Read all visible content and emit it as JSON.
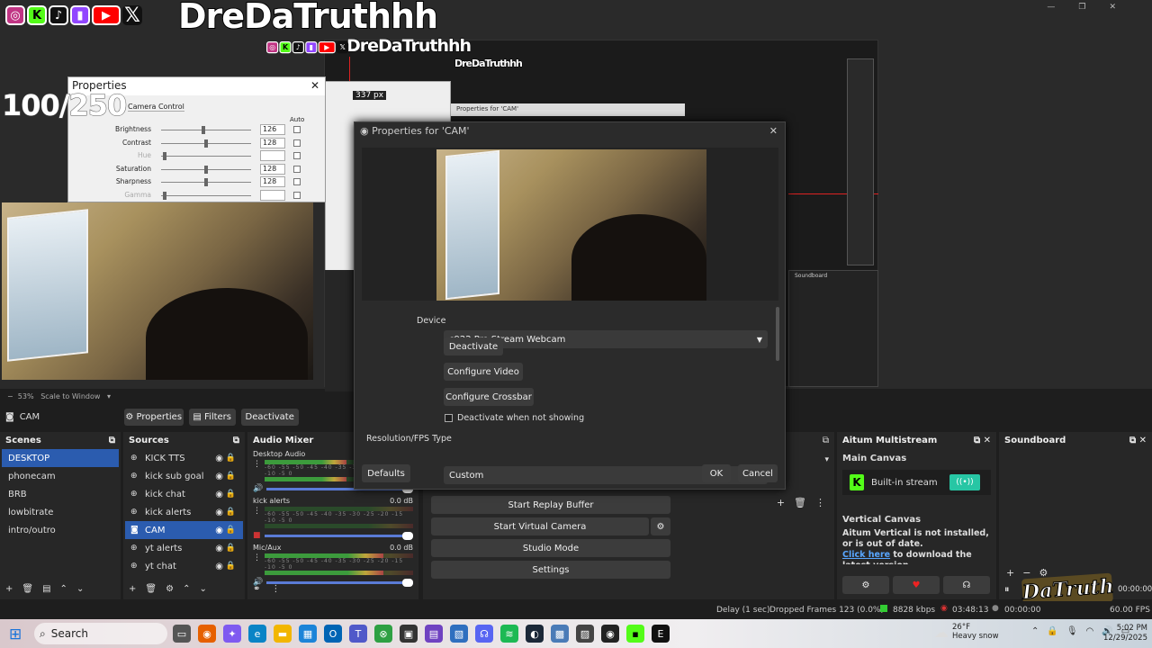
{
  "overlay": {
    "handle": "DreDaTruthhh",
    "social_icons": [
      "instagram-icon",
      "kick-icon",
      "tiktok-icon",
      "twitch-icon",
      "youtube-icon",
      "x-icon"
    ],
    "counter": "100/250"
  },
  "camera_props": {
    "title": "Properties",
    "tab": "Camera Control",
    "auto_label": "Auto",
    "rows": [
      {
        "label": "Brightness",
        "value": "126",
        "level": 0.45
      },
      {
        "label": "Contrast",
        "value": "128",
        "level": 0.48
      },
      {
        "label": "Hue",
        "value": "",
        "level": 0.02
      },
      {
        "label": "Saturation",
        "value": "128",
        "level": 0.48
      },
      {
        "label": "Sharpness",
        "value": "128",
        "level": 0.48
      },
      {
        "label": "Gamma",
        "value": "",
        "level": 0.02
      }
    ]
  },
  "nested": {
    "px_label": "337 px",
    "props_small": "Properties for 'CAM'",
    "soundboard_small": "Soundboard"
  },
  "preview_bar": {
    "zoom": "53%",
    "scale": "Scale to Window"
  },
  "toolbar": {
    "source": "CAM",
    "properties": "Properties",
    "filters": "Filters",
    "deactivate": "Deactivate"
  },
  "scenes": {
    "title": "Scenes",
    "items": [
      "DESKTOP",
      "phonecam",
      "BRB",
      "lowbitrate",
      "intro/outro"
    ],
    "selected": 0
  },
  "sources": {
    "title": "Sources",
    "items": [
      "KICK TTS",
      "kick sub goal",
      "kick chat",
      "kick alerts",
      "CAM",
      "yt alerts",
      "yt chat"
    ],
    "selected": 4
  },
  "mixer": {
    "title": "Audio Mixer",
    "channels": [
      {
        "name": "Desktop Audio",
        "db": ""
      },
      {
        "name": "kick alerts",
        "db": "0.0 dB"
      },
      {
        "name": "Mic/Aux",
        "db": "0.0 dB"
      }
    ],
    "scale": "-60 -55 -50 -45 -40 -35 -30 -25 -20 -15 -10 -5 0"
  },
  "controls": [
    "Start Replay Buffer",
    "Start Virtual Camera",
    "Studio Mode",
    "Settings"
  ],
  "aitum": {
    "title": "Aitum Multistream",
    "main_canvas": "Main Canvas",
    "builtin": "Built-in stream",
    "vertical_title": "Vertical Canvas",
    "vertical_msg": "Aitum Vertical is not installed, or is out of date.",
    "click_here": "Click here",
    "download_msg": "to download the latest version"
  },
  "soundboard": {
    "title": "Soundboard",
    "time": "00:00:00",
    "fps": "60.00 FPS"
  },
  "dialog": {
    "title": "Properties for 'CAM'",
    "device_label": "Device",
    "device_value": "c922 Pro Stream Webcam",
    "deactivate": "Deactivate",
    "configure_video": "Configure Video",
    "configure_crossbar": "Configure Crossbar",
    "deactivate_when": "Deactivate when not showing",
    "res_label": "Resolution/FPS Type",
    "res_value": "Custom",
    "defaults": "Defaults",
    "ok": "OK",
    "cancel": "Cancel"
  },
  "status": {
    "delay": "Delay (1 sec)",
    "dropped": "Dropped Frames 123 (0.0%)",
    "kbps": "8828 kbps",
    "time": "03:48:13",
    "rec_time": "00:00:00",
    "fps": "60.00 FPS"
  },
  "taskbar": {
    "search": "Search",
    "weather_temp": "26°F",
    "weather_desc": "Heavy snow",
    "clock_time": "5:02 PM",
    "clock_date": "12/29/2025"
  },
  "colors": {
    "accent": "#2b5caf",
    "kick": "#53fc18",
    "dock": "#272727",
    "bg": "#1e1e1e"
  }
}
